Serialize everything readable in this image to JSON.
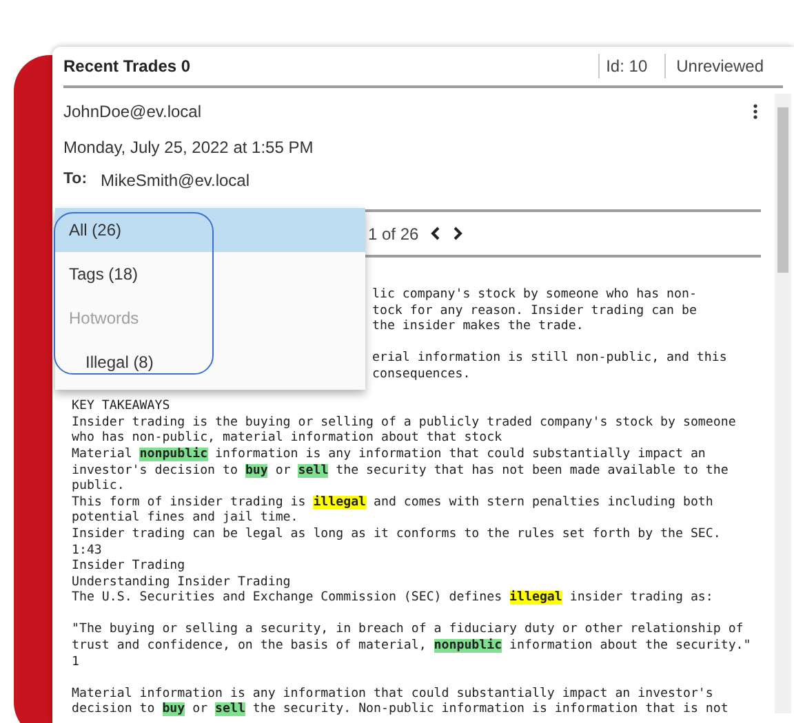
{
  "header": {
    "title": "Recent Trades 0",
    "id": "Id: 10",
    "status": "Unreviewed"
  },
  "email": {
    "from": "JohnDoe@ev.local",
    "date": "Monday, July 25, 2022 at 1:55 PM",
    "to_label": "To:",
    "to": "MikeSmith@ev.local"
  },
  "pager": {
    "text": "1 of 26"
  },
  "filter_menu": {
    "items": [
      {
        "kind": "option",
        "label": "All (26)",
        "selected": true
      },
      {
        "kind": "option",
        "label": "Tags (18)",
        "selected": false
      },
      {
        "kind": "group",
        "label": "Hotwords"
      },
      {
        "kind": "sub",
        "label": "Illegal (8)",
        "selected": false
      }
    ]
  },
  "hidden_lines": [
    {
      "text": "lic company's stock by someone who has non-"
    },
    {
      "text": "tock for any reason. Insider trading can be"
    },
    {
      "text": "the insider makes the trade."
    },
    {
      "text": "erial information is still non-public, and this",
      "space_before": true
    },
    {
      "text": "consequences."
    }
  ],
  "body_lines": [
    {
      "space_before": true,
      "segments": [
        {
          "text": "KEY TAKEAWAYS"
        }
      ]
    },
    {
      "segments": [
        {
          "text": "Insider trading is the buying or selling of a publicly traded company's stock by someone"
        }
      ]
    },
    {
      "segments": [
        {
          "text": "who has non-public, material information about that stock"
        }
      ]
    },
    {
      "segments": [
        {
          "text": "Material "
        },
        {
          "text": "nonpublic",
          "color": "#7fe08f"
        },
        {
          "text": " information is any information that could substantially impact an"
        }
      ]
    },
    {
      "segments": [
        {
          "text": "investor's decision to "
        },
        {
          "text": "buy",
          "color": "#7fe08f"
        },
        {
          "text": " or "
        },
        {
          "text": "sell",
          "color": "#7fe08f"
        },
        {
          "text": " the security that has not been made available to the"
        }
      ]
    },
    {
      "segments": [
        {
          "text": "public."
        }
      ]
    },
    {
      "segments": [
        {
          "text": "This form of insider trading is "
        },
        {
          "text": "illegal",
          "color": "#ffff00"
        },
        {
          "text": " and comes with stern penalties including both"
        }
      ]
    },
    {
      "segments": [
        {
          "text": "potential fines and jail time."
        }
      ]
    },
    {
      "segments": [
        {
          "text": "Insider trading can be legal as long as it conforms to the rules set forth by the SEC."
        }
      ]
    },
    {
      "segments": [
        {
          "text": "1:43"
        }
      ]
    },
    {
      "segments": [
        {
          "text": "Insider Trading"
        }
      ]
    },
    {
      "segments": [
        {
          "text": "Understanding Insider Trading"
        }
      ]
    },
    {
      "segments": [
        {
          "text": "The U.S. Securities and Exchange Commission (SEC) defines "
        },
        {
          "text": "illegal",
          "color": "#ffff00"
        },
        {
          "text": " insider trading as:"
        }
      ]
    },
    {
      "space_before": true,
      "segments": [
        {
          "text": "\"The buying or selling a security, in breach of a fiduciary duty or other relationship of"
        }
      ]
    },
    {
      "segments": [
        {
          "text": "trust and confidence, on the basis of material, "
        },
        {
          "text": "nonpublic",
          "color": "#7fe08f"
        },
        {
          "text": " information about the security.\""
        }
      ]
    },
    {
      "segments": [
        {
          "text": "1"
        }
      ]
    },
    {
      "space_before": true,
      "segments": [
        {
          "text": "Material information is any information that could substantially impact an investor's"
        }
      ]
    },
    {
      "segments": [
        {
          "text": "decision to "
        },
        {
          "text": "buy",
          "color": "#7fe08f"
        },
        {
          "text": " or "
        },
        {
          "text": "sell",
          "color": "#7fe08f"
        },
        {
          "text": " the security. Non-public information is information that is not"
        }
      ]
    }
  ]
}
